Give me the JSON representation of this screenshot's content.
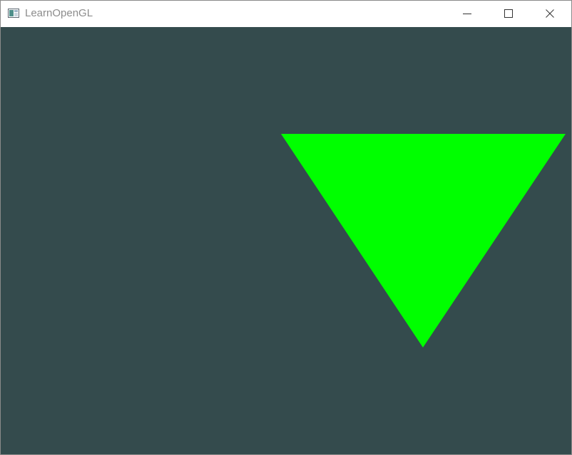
{
  "window": {
    "title": "LearnOpenGL",
    "controls": {
      "minimize_icon": "minimize-icon",
      "maximize_icon": "maximize-icon",
      "close_icon": "close-icon"
    }
  },
  "scene": {
    "clear_color": "#344b4d",
    "triangle": {
      "color": "#00ff00",
      "shape": "downward-pointing triangle"
    }
  }
}
